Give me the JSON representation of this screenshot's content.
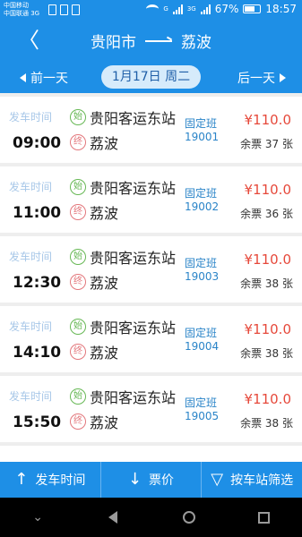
{
  "status_bar": {
    "carrier_1": "中国移动",
    "carrier_2": "中国联通 3G",
    "network_1": "G",
    "network_2": "3G",
    "battery": "67%",
    "battery_level": 0.67,
    "time": "18:57"
  },
  "header": {
    "origin": "贵阳市",
    "destination": "荔波"
  },
  "date_nav": {
    "prev_label": "前一天",
    "current_date": "1月17日 周二",
    "next_label": "后一天"
  },
  "list": {
    "depart_label": "发车时间",
    "start_badge": "始",
    "end_badge": "终",
    "rows": [
      {
        "time": "09:00",
        "from": "贵阳客运东站",
        "to": "荔波",
        "bus_type": "固定班",
        "bus_no": "19001",
        "price": "¥110.0",
        "tickets": "余票 37 张"
      },
      {
        "time": "11:00",
        "from": "贵阳客运东站",
        "to": "荔波",
        "bus_type": "固定班",
        "bus_no": "19002",
        "price": "¥110.0",
        "tickets": "余票 36 张"
      },
      {
        "time": "12:30",
        "from": "贵阳客运东站",
        "to": "荔波",
        "bus_type": "固定班",
        "bus_no": "19003",
        "price": "¥110.0",
        "tickets": "余票 38 张"
      },
      {
        "time": "14:10",
        "from": "贵阳客运东站",
        "to": "荔波",
        "bus_type": "固定班",
        "bus_no": "19004",
        "price": "¥110.0",
        "tickets": "余票 38 张"
      },
      {
        "time": "15:50",
        "from": "贵阳客运东站",
        "to": "荔波",
        "bus_type": "固定班",
        "bus_no": "19005",
        "price": "¥110.0",
        "tickets": "余票 38 张"
      }
    ]
  },
  "bottom_bar": {
    "sort_time_label": "发车时间",
    "sort_price_label": "票价",
    "filter_label": "按车站筛选"
  },
  "colors": {
    "primary": "#1e8fe6",
    "price": "#e6493b",
    "start_badge": "#67b855",
    "end_badge": "#e3777c"
  },
  "icons": {
    "back": "chevron-left-icon",
    "sort_time": "arrow-up-icon",
    "sort_price": "arrow-down-icon",
    "filter": "funnel-icon"
  }
}
